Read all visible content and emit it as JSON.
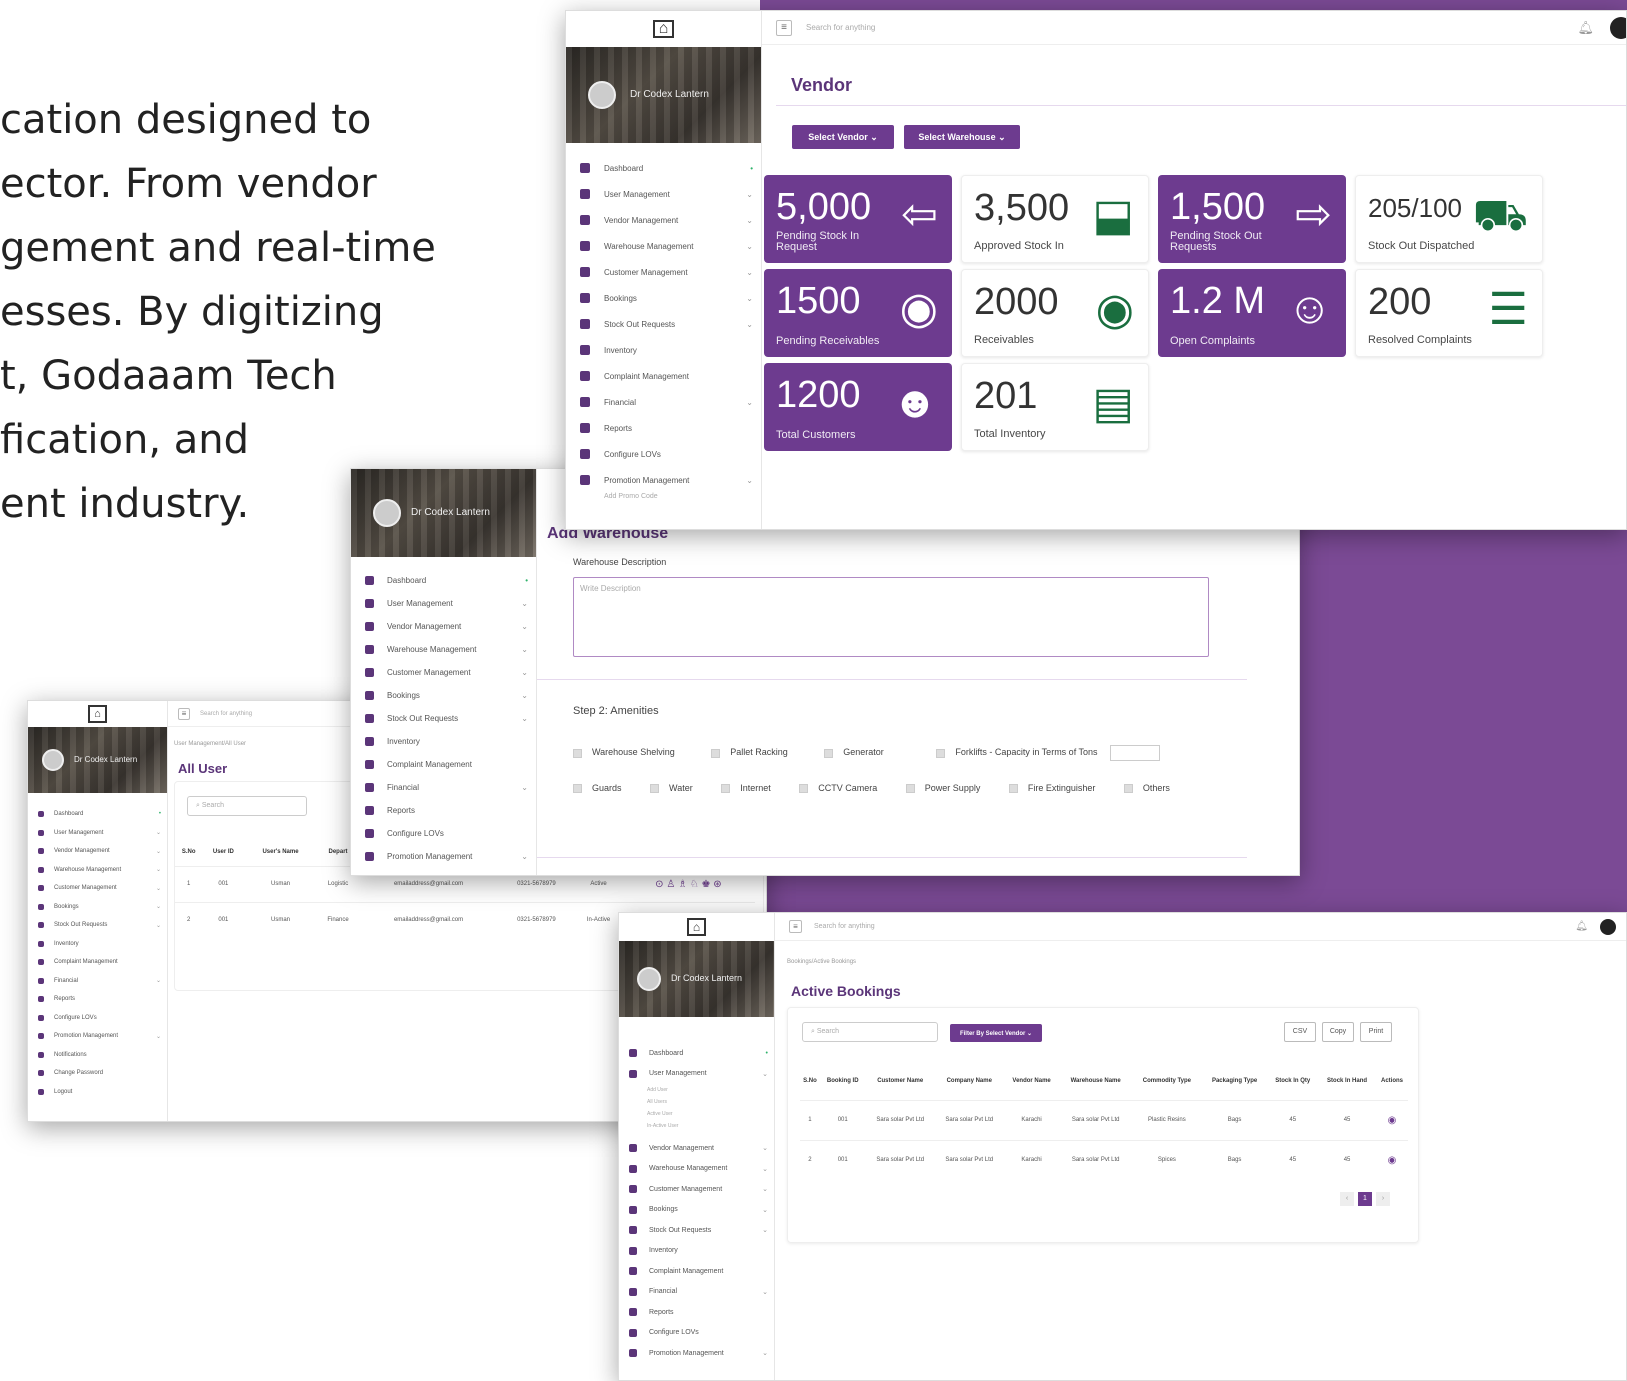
{
  "intro_text": "cation designed to\nector. From vendor\ngement and real-time\nesses. By digitizing\nt, Godaaam Tech\nfication, and\nent industry.",
  "user_name": "Dr Codex Lantern",
  "search_placeholder": "Search for anything",
  "colors": {
    "purple": "#6d3b8f",
    "bg": "#7b4a95"
  },
  "menu": [
    {
      "label": "Dashboard",
      "icon": "dashboard-icon"
    },
    {
      "label": "User Management",
      "icon": "users-icon"
    },
    {
      "label": "Vendor Management",
      "icon": "vendor-icon"
    },
    {
      "label": "Warehouse Management",
      "icon": "warehouse-icon"
    },
    {
      "label": "Customer Management",
      "icon": "customer-icon"
    },
    {
      "label": "Bookings",
      "icon": "bookings-icon"
    },
    {
      "label": "Stock Out Requests",
      "icon": "truck-icon"
    },
    {
      "label": "Inventory",
      "icon": "inventory-icon"
    },
    {
      "label": "Complaint Management",
      "icon": "alert-icon"
    },
    {
      "label": "Financial",
      "icon": "financial-icon"
    },
    {
      "label": "Reports",
      "icon": "reports-icon"
    },
    {
      "label": "Configure LOVs",
      "icon": "config-icon"
    },
    {
      "label": "Promotion Management",
      "icon": "promotion-icon"
    }
  ],
  "menu_extra": {
    "notifications": "Notifications",
    "change_password": "Change Password",
    "logout": "Logout"
  },
  "vendor": {
    "title": "Vendor",
    "select_vendor": "Select Vendor ⌄",
    "select_warehouse": "Select Warehouse ⌄",
    "promo_sub": "Add Promo Code",
    "cards": [
      {
        "value": "5,000",
        "label": "Pending Stock In Request",
        "style": "p",
        "icon": "⇦"
      },
      {
        "value": "3,500",
        "label": "Approved Stock In",
        "style": "w",
        "icon": "⬓"
      },
      {
        "value": "1,500",
        "label": "Pending Stock Out Requests",
        "style": "p",
        "icon": "⇨"
      },
      {
        "value": "205/100",
        "label": "Stock Out Dispatched",
        "style": "w",
        "icon": "⛟"
      },
      {
        "value": "1500",
        "label": "Pending Receivables",
        "style": "p",
        "icon": "◉"
      },
      {
        "value": "2000",
        "label": "Receivables",
        "style": "w",
        "icon": "◉"
      },
      {
        "value": "1.2 M",
        "label": "Open Complaints",
        "style": "p",
        "icon": "☺"
      },
      {
        "value": "200",
        "label": "Resolved Complaints",
        "style": "w",
        "icon": "☰"
      },
      {
        "value": "1200",
        "label": "Total Customers",
        "style": "p",
        "icon": "☻"
      },
      {
        "value": "201",
        "label": "Total Inventory",
        "style": "w",
        "icon": "▤"
      }
    ]
  },
  "warehouse": {
    "title": "Add Warehouse",
    "desc_label": "Warehouse Description",
    "desc_placeholder": "Write Description",
    "step2": "Step 2: Amenities",
    "row1": [
      "Warehouse Shelving",
      "Pallet Racking",
      "Generator",
      "Forklifts - Capacity in Terms of Tons"
    ],
    "row2": [
      "Guards",
      "Water",
      "Internet",
      "CCTV Camera",
      "Power Supply",
      "Fire Extinguisher",
      "Others"
    ]
  },
  "users": {
    "breadcrumb": "User Management/All User",
    "title": "All User",
    "search": "Search",
    "headers": [
      "S.No",
      "User ID",
      "User's Name",
      "Depart"
    ],
    "rows": [
      [
        "1",
        "001",
        "Usman",
        "Logistic",
        "emailaddress@gmail.com",
        "0321-5678979",
        "Active"
      ],
      [
        "2",
        "001",
        "Usman",
        "Finance",
        "emailaddress@gmail.com",
        "0321-5678979",
        "In-Active"
      ]
    ],
    "actions": "⊙ ♙ ♗ ♘ ♚ ⊛"
  },
  "bookings": {
    "breadcrumb": "Bookings/Active Bookings",
    "title": "Active Bookings",
    "search": "Search",
    "filter": "Filter By Select Vendor ⌄",
    "csv": "CSV",
    "copy": "Copy",
    "print": "Print",
    "sub_items": [
      "Add User",
      "All Users",
      "Active User",
      "In-Active User"
    ],
    "headers": [
      "S.No",
      "Booking ID",
      "Customer Name",
      "Company Name",
      "Vendor Name",
      "Warehouse Name",
      "Commodity Type",
      "Packaging Type",
      "Stock In Qty",
      "Stock In Hand",
      "Actions"
    ],
    "rows": [
      [
        "1",
        "001",
        "Sara solar Pvt Ltd",
        "Sara solar Pvt Ltd",
        "Karachi",
        "Sara solar Pvt Ltd",
        "Plastic Resins",
        "Bags",
        "45",
        "45"
      ],
      [
        "2",
        "001",
        "Sara solar Pvt Ltd",
        "Sara solar Pvt Ltd",
        "Karachi",
        "Sara solar Pvt Ltd",
        "Spices",
        "Bags",
        "45",
        "45"
      ]
    ],
    "page": "1"
  }
}
